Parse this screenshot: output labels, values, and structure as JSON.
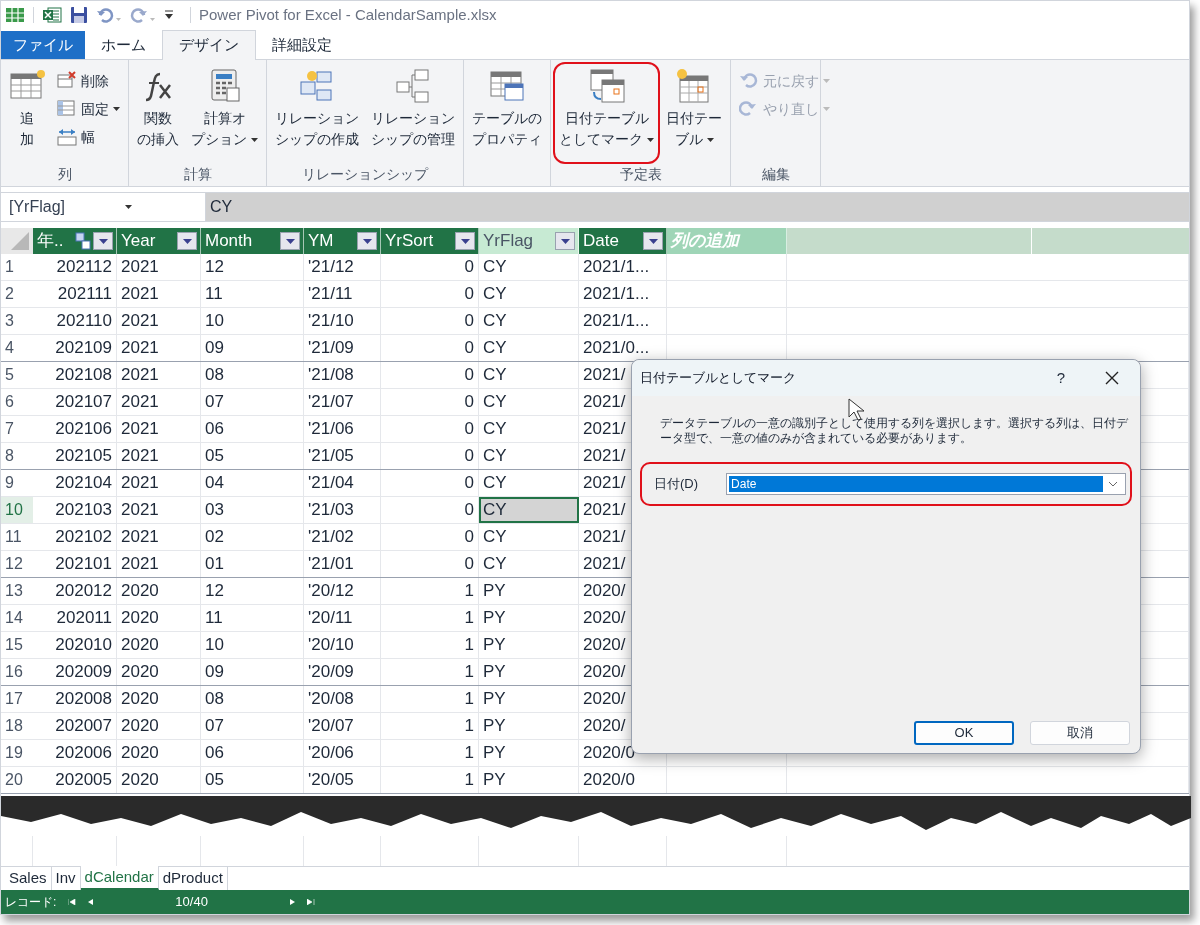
{
  "title_bar": {
    "title": "Power Pivot for Excel - CalendarSample.xlsx"
  },
  "ribbon_tabs": [
    {
      "label": "ファイル",
      "kind": "file",
      "selected": false
    },
    {
      "label": "ホーム",
      "kind": "tab",
      "selected": false
    },
    {
      "label": "デザイン",
      "kind": "tab",
      "selected": true
    },
    {
      "label": "詳細設定",
      "kind": "tab",
      "selected": false
    }
  ],
  "ribbon_groups": [
    {
      "label": "列",
      "buttons": [
        {
          "kind": "large",
          "lines": [
            "追",
            "加"
          ],
          "dropdown": false,
          "disabled": false,
          "highlighted": false
        },
        {
          "kind": "small",
          "lines": [
            "削除"
          ],
          "dropdown": false,
          "disabled": false,
          "highlighted": false
        },
        {
          "kind": "small",
          "lines": [
            "固定"
          ],
          "dropdown": true,
          "disabled": false,
          "highlighted": false
        },
        {
          "kind": "small",
          "lines": [
            "幅"
          ],
          "dropdown": false,
          "disabled": false,
          "highlighted": false
        }
      ]
    },
    {
      "label": "計算",
      "buttons": [
        {
          "kind": "large",
          "lines": [
            "関数",
            "の挿入"
          ],
          "dropdown": false,
          "disabled": false,
          "highlighted": false
        },
        {
          "kind": "large",
          "lines": [
            "計算オ",
            "プション"
          ],
          "dropdown": true,
          "disabled": false,
          "highlighted": false
        }
      ]
    },
    {
      "label": "リレーションシップ",
      "buttons": [
        {
          "kind": "large",
          "lines": [
            "リレーション",
            "シップの作成"
          ],
          "dropdown": false,
          "disabled": false,
          "highlighted": false
        },
        {
          "kind": "large",
          "lines": [
            "リレーション",
            "シップの管理"
          ],
          "dropdown": false,
          "disabled": false,
          "highlighted": false
        }
      ]
    },
    {
      "buttons": [
        {
          "kind": "large",
          "lines": [
            "テーブルの",
            "プロパティ"
          ],
          "dropdown": false,
          "disabled": false,
          "highlighted": false
        }
      ]
    },
    {
      "label": "予定表",
      "buttons": [
        {
          "kind": "large",
          "lines": [
            "日付テーブル",
            "としてマーク"
          ],
          "dropdown": true,
          "disabled": false,
          "highlighted": true
        },
        {
          "kind": "large",
          "lines": [
            "日付テー",
            "ブル"
          ],
          "dropdown": true,
          "disabled": false,
          "highlighted": false
        }
      ]
    },
    {
      "label": "編集",
      "buttons": [
        {
          "kind": "small",
          "lines": [
            "元に戻す"
          ],
          "dropdown": true,
          "disabled": true,
          "highlighted": false
        },
        {
          "kind": "small",
          "lines": [
            "やり直し"
          ],
          "dropdown": true,
          "disabled": true,
          "highlighted": false
        }
      ]
    }
  ],
  "formula_bar": {
    "name_box": "[YrFlag]",
    "value": "CY"
  },
  "table": {
    "columns": [
      {
        "label": "年..",
        "kind": "data",
        "sorted": true,
        "selected": false
      },
      {
        "label": "Year",
        "kind": "data",
        "sorted": false,
        "selected": false
      },
      {
        "label": "Month",
        "kind": "data",
        "sorted": false,
        "selected": false
      },
      {
        "label": "YM",
        "kind": "data",
        "sorted": false,
        "selected": false
      },
      {
        "label": "YrSort",
        "kind": "data",
        "sorted": false,
        "selected": false
      },
      {
        "label": "YrFlag",
        "kind": "data",
        "sorted": false,
        "selected": true
      },
      {
        "label": "Date",
        "kind": "data",
        "sorted": false,
        "selected": false
      },
      {
        "label": "列の追加",
        "kind": "add",
        "sorted": false,
        "selected": false
      }
    ],
    "rows": [
      {
        "number": "1",
        "selected": false,
        "cells": [
          "202112",
          "2021",
          "12",
          "'21/12",
          "0",
          "CY",
          "2021/1..."
        ]
      },
      {
        "number": "2",
        "selected": false,
        "cells": [
          "202111",
          "2021",
          "11",
          "'21/11",
          "0",
          "CY",
          "2021/1..."
        ]
      },
      {
        "number": "3",
        "selected": false,
        "cells": [
          "202110",
          "2021",
          "10",
          "'21/10",
          "0",
          "CY",
          "2021/1..."
        ]
      },
      {
        "number": "4",
        "selected": false,
        "cells": [
          "202109",
          "2021",
          "09",
          "'21/09",
          "0",
          "CY",
          "2021/0..."
        ]
      },
      {
        "number": "5",
        "selected": false,
        "cells": [
          "202108",
          "2021",
          "08",
          "'21/08",
          "0",
          "CY",
          "2021/"
        ]
      },
      {
        "number": "6",
        "selected": false,
        "cells": [
          "202107",
          "2021",
          "07",
          "'21/07",
          "0",
          "CY",
          "2021/"
        ]
      },
      {
        "number": "7",
        "selected": false,
        "cells": [
          "202106",
          "2021",
          "06",
          "'21/06",
          "0",
          "CY",
          "2021/"
        ]
      },
      {
        "number": "8",
        "selected": false,
        "cells": [
          "202105",
          "2021",
          "05",
          "'21/05",
          "0",
          "CY",
          "2021/"
        ]
      },
      {
        "number": "9",
        "selected": false,
        "cells": [
          "202104",
          "2021",
          "04",
          "'21/04",
          "0",
          "CY",
          "2021/"
        ]
      },
      {
        "number": "10",
        "selected": true,
        "cells": [
          "202103",
          "2021",
          "03",
          "'21/03",
          "0",
          "CY",
          "2021/"
        ]
      },
      {
        "number": "11",
        "selected": false,
        "cells": [
          "202102",
          "2021",
          "02",
          "'21/02",
          "0",
          "CY",
          "2021/"
        ]
      },
      {
        "number": "12",
        "selected": false,
        "cells": [
          "202101",
          "2021",
          "01",
          "'21/01",
          "0",
          "CY",
          "2021/"
        ]
      },
      {
        "number": "13",
        "selected": false,
        "cells": [
          "202012",
          "2020",
          "12",
          "'20/12",
          "1",
          "PY",
          "2020/"
        ]
      },
      {
        "number": "14",
        "selected": false,
        "cells": [
          "202011",
          "2020",
          "11",
          "'20/11",
          "1",
          "PY",
          "2020/"
        ]
      },
      {
        "number": "15",
        "selected": false,
        "cells": [
          "202010",
          "2020",
          "10",
          "'20/10",
          "1",
          "PY",
          "2020/"
        ]
      },
      {
        "number": "16",
        "selected": false,
        "cells": [
          "202009",
          "2020",
          "09",
          "'20/09",
          "1",
          "PY",
          "2020/"
        ]
      },
      {
        "number": "17",
        "selected": false,
        "cells": [
          "202008",
          "2020",
          "08",
          "'20/08",
          "1",
          "PY",
          "2020/"
        ]
      },
      {
        "number": "18",
        "selected": false,
        "cells": [
          "202007",
          "2020",
          "07",
          "'20/07",
          "1",
          "PY",
          "2020/"
        ]
      },
      {
        "number": "19",
        "selected": false,
        "cells": [
          "202006",
          "2020",
          "06",
          "'20/06",
          "1",
          "PY",
          "2020/0"
        ]
      },
      {
        "number": "20",
        "selected": false,
        "cells": [
          "202005",
          "2020",
          "05",
          "'20/05",
          "1",
          "PY",
          "2020/0"
        ]
      }
    ]
  },
  "sheet_tabs": [
    {
      "label": "Sales",
      "selected": false
    },
    {
      "label": "Inv",
      "selected": false
    },
    {
      "label": "dCalendar",
      "selected": true
    },
    {
      "label": "dProduct",
      "selected": false
    }
  ],
  "status_bar": {
    "label": "レコード:",
    "position": "10/40"
  },
  "dialog": {
    "title": "日付テーブルとしてマーク",
    "help": "?",
    "description": "データテーブルの一意の識別子として使用する列を選択します。選択する列は、日付データ型で、一意の値のみが含まれている必要があります。",
    "field_label": "日付(D)",
    "field_value": "Date",
    "field_highlighted": true,
    "buttons": [
      {
        "label": "OK",
        "default": true
      },
      {
        "label": "取消",
        "default": false
      }
    ]
  }
}
